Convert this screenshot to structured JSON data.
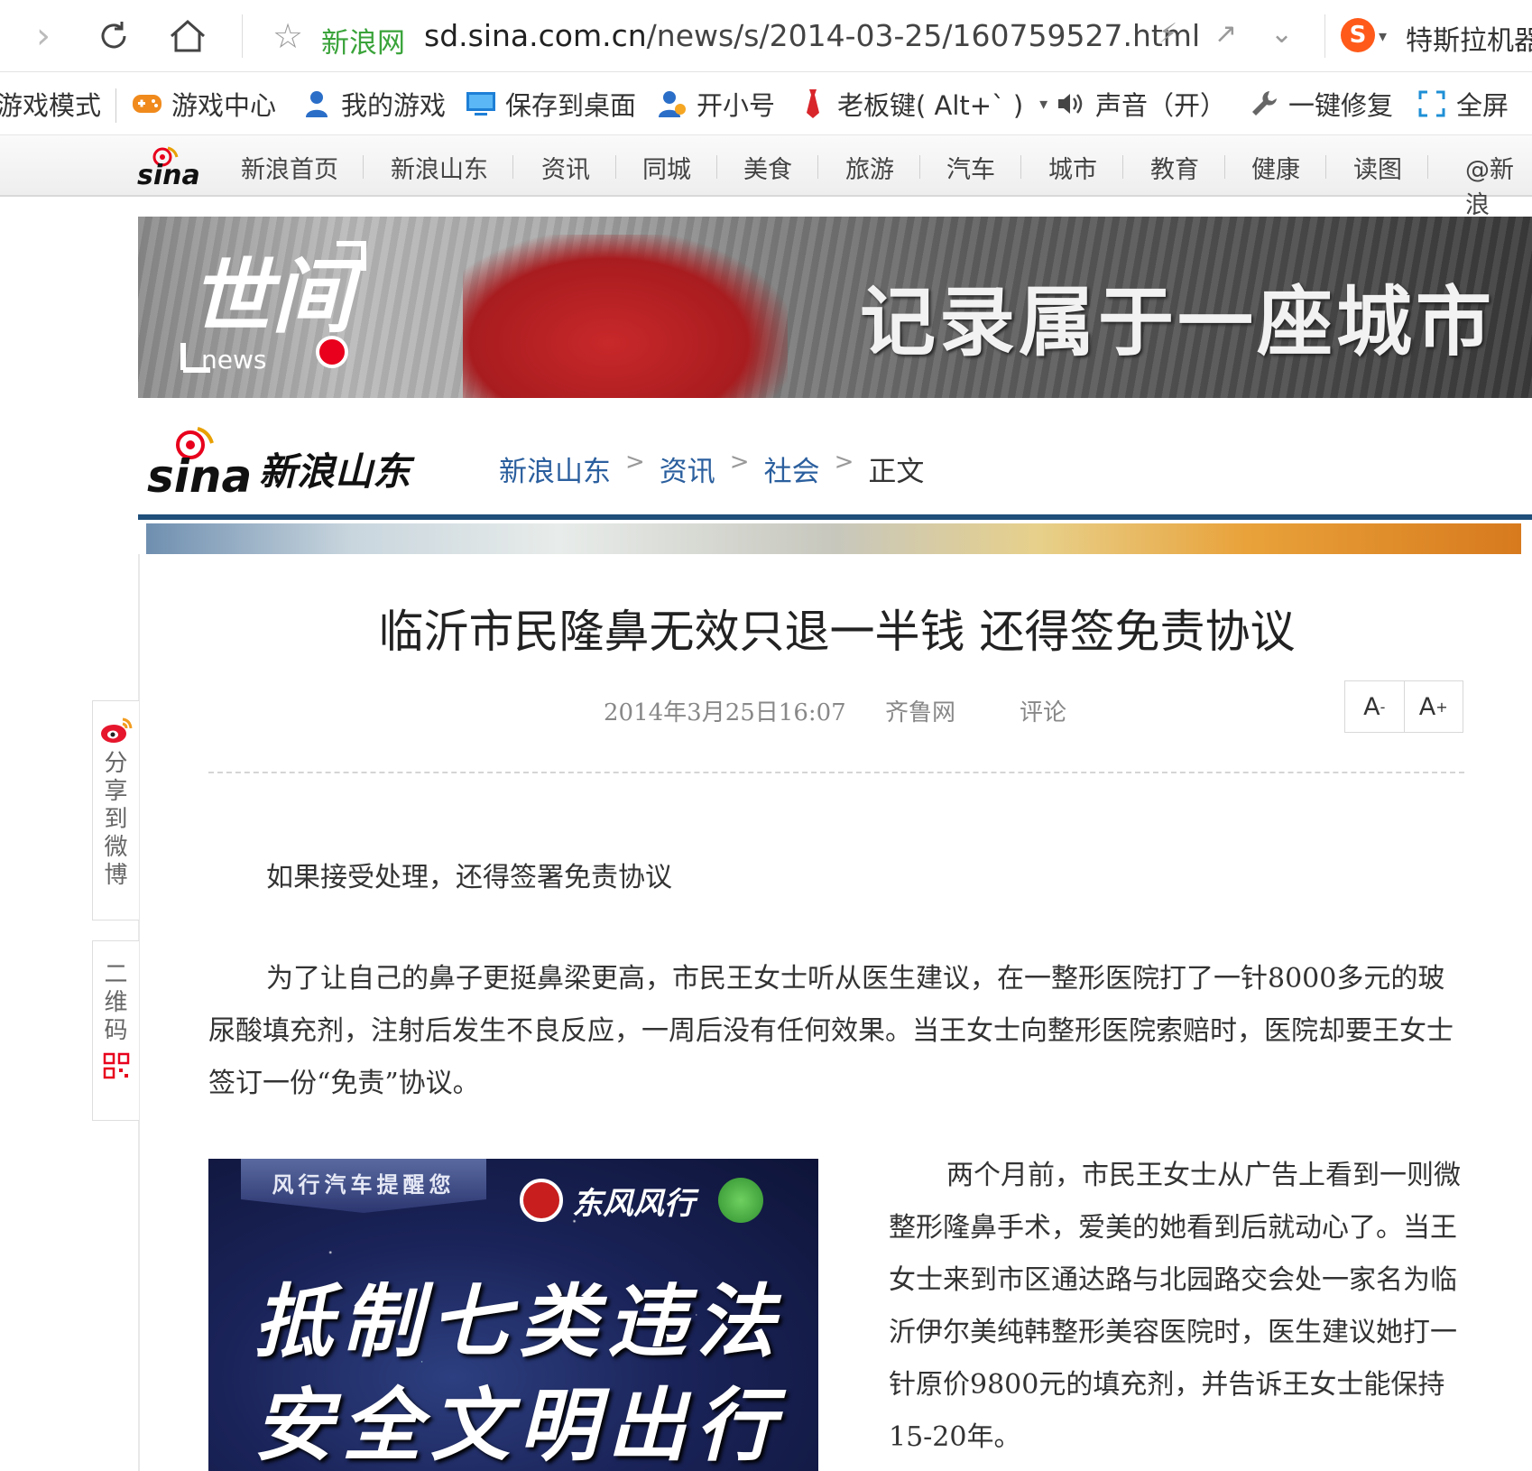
{
  "browser": {
    "site_name": "新浪网",
    "url_host": "sd.sina.com.cn",
    "url_path": "/news/s/2014-03-25/160759527.html",
    "search_text": "特斯拉机器"
  },
  "toolbar": {
    "items": [
      {
        "label": "游戏模式",
        "icon": "game-mode-icon"
      },
      {
        "label": "游戏中心",
        "icon": "gamepad-icon"
      },
      {
        "label": "我的游戏",
        "icon": "user-icon"
      },
      {
        "label": "保存到桌面",
        "icon": "monitor-icon"
      },
      {
        "label": "开小号",
        "icon": "user-add-icon"
      },
      {
        "label": "老板键( Alt+` )",
        "icon": "tie-icon"
      },
      {
        "label": "声音（开）",
        "icon": "speaker-icon"
      },
      {
        "label": "一键修复",
        "icon": "wrench-icon"
      },
      {
        "label": "全屏",
        "icon": "fullscreen-icon"
      }
    ]
  },
  "sina_nav": {
    "links": [
      "新浪首页",
      "新浪山东",
      "资讯",
      "同城",
      "美食",
      "旅游",
      "汽车",
      "城市",
      "教育",
      "健康",
      "读图",
      "@新浪"
    ]
  },
  "banner": {
    "logo_text": "世间",
    "logo_sub": "news",
    "slogan": "记录属于一座城市"
  },
  "channel": {
    "logo_text": "新浪山东",
    "breadcrumb": [
      "新浪山东",
      "资讯",
      "社会"
    ],
    "breadcrumb_current": "正文"
  },
  "article": {
    "title": "临沂市民隆鼻无效只退一半钱 还得签免责协议",
    "date": "2014年3月25日16:07",
    "source": "齐鲁网",
    "comment_label": "评论",
    "font_smaller": "A",
    "font_larger": "A",
    "lead": "如果接受处理，还得签署免责协议",
    "paragraph1": "为了让自己的鼻子更挺鼻梁更高，市民王女士听从医生建议，在一整形医院打了一针8000多元的玻尿酸填充剂，注射后发生不良反应，一周后没有任何效果。当王女士向整形医院索赔时，医院却要王女士签订一份“免责”协议。",
    "paragraph2": "两个月前，市民王女士从广告上看到一则微整形隆鼻手术，爱美的她看到后就动心了。当王女士来到市区通达路与北园路交会处一家名为临沂伊尔美纯韩整形美容医院时，医生建议她打一针原价9800元的填充剂，并告诉王女士能保持15-20年。"
  },
  "ad": {
    "tag": "风行汽车提醒您",
    "brand": "东风风行",
    "line1": "抵制七类违法",
    "line2": "安全文明出行"
  },
  "share_rail": {
    "weibo_label": "分享到微博",
    "qr_label": "二维码"
  }
}
